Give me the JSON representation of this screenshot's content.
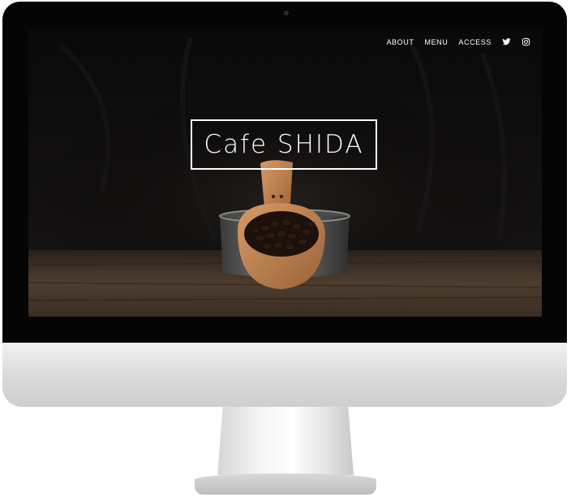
{
  "site": {
    "title": "Cafe SHIDA"
  },
  "nav": {
    "items": [
      {
        "label": "ABOUT"
      },
      {
        "label": "MENU"
      },
      {
        "label": "ACCESS"
      }
    ],
    "icons": [
      "twitter-icon",
      "instagram-icon"
    ]
  },
  "colors": {
    "screen_background": "#0b0a0a",
    "table_wood": "#4a3a2c",
    "scoop_wood": "#c48a5a",
    "nav_text": "#ffffff",
    "monitor_bezel": "#050505",
    "monitor_chin": "#dcdcdc"
  }
}
